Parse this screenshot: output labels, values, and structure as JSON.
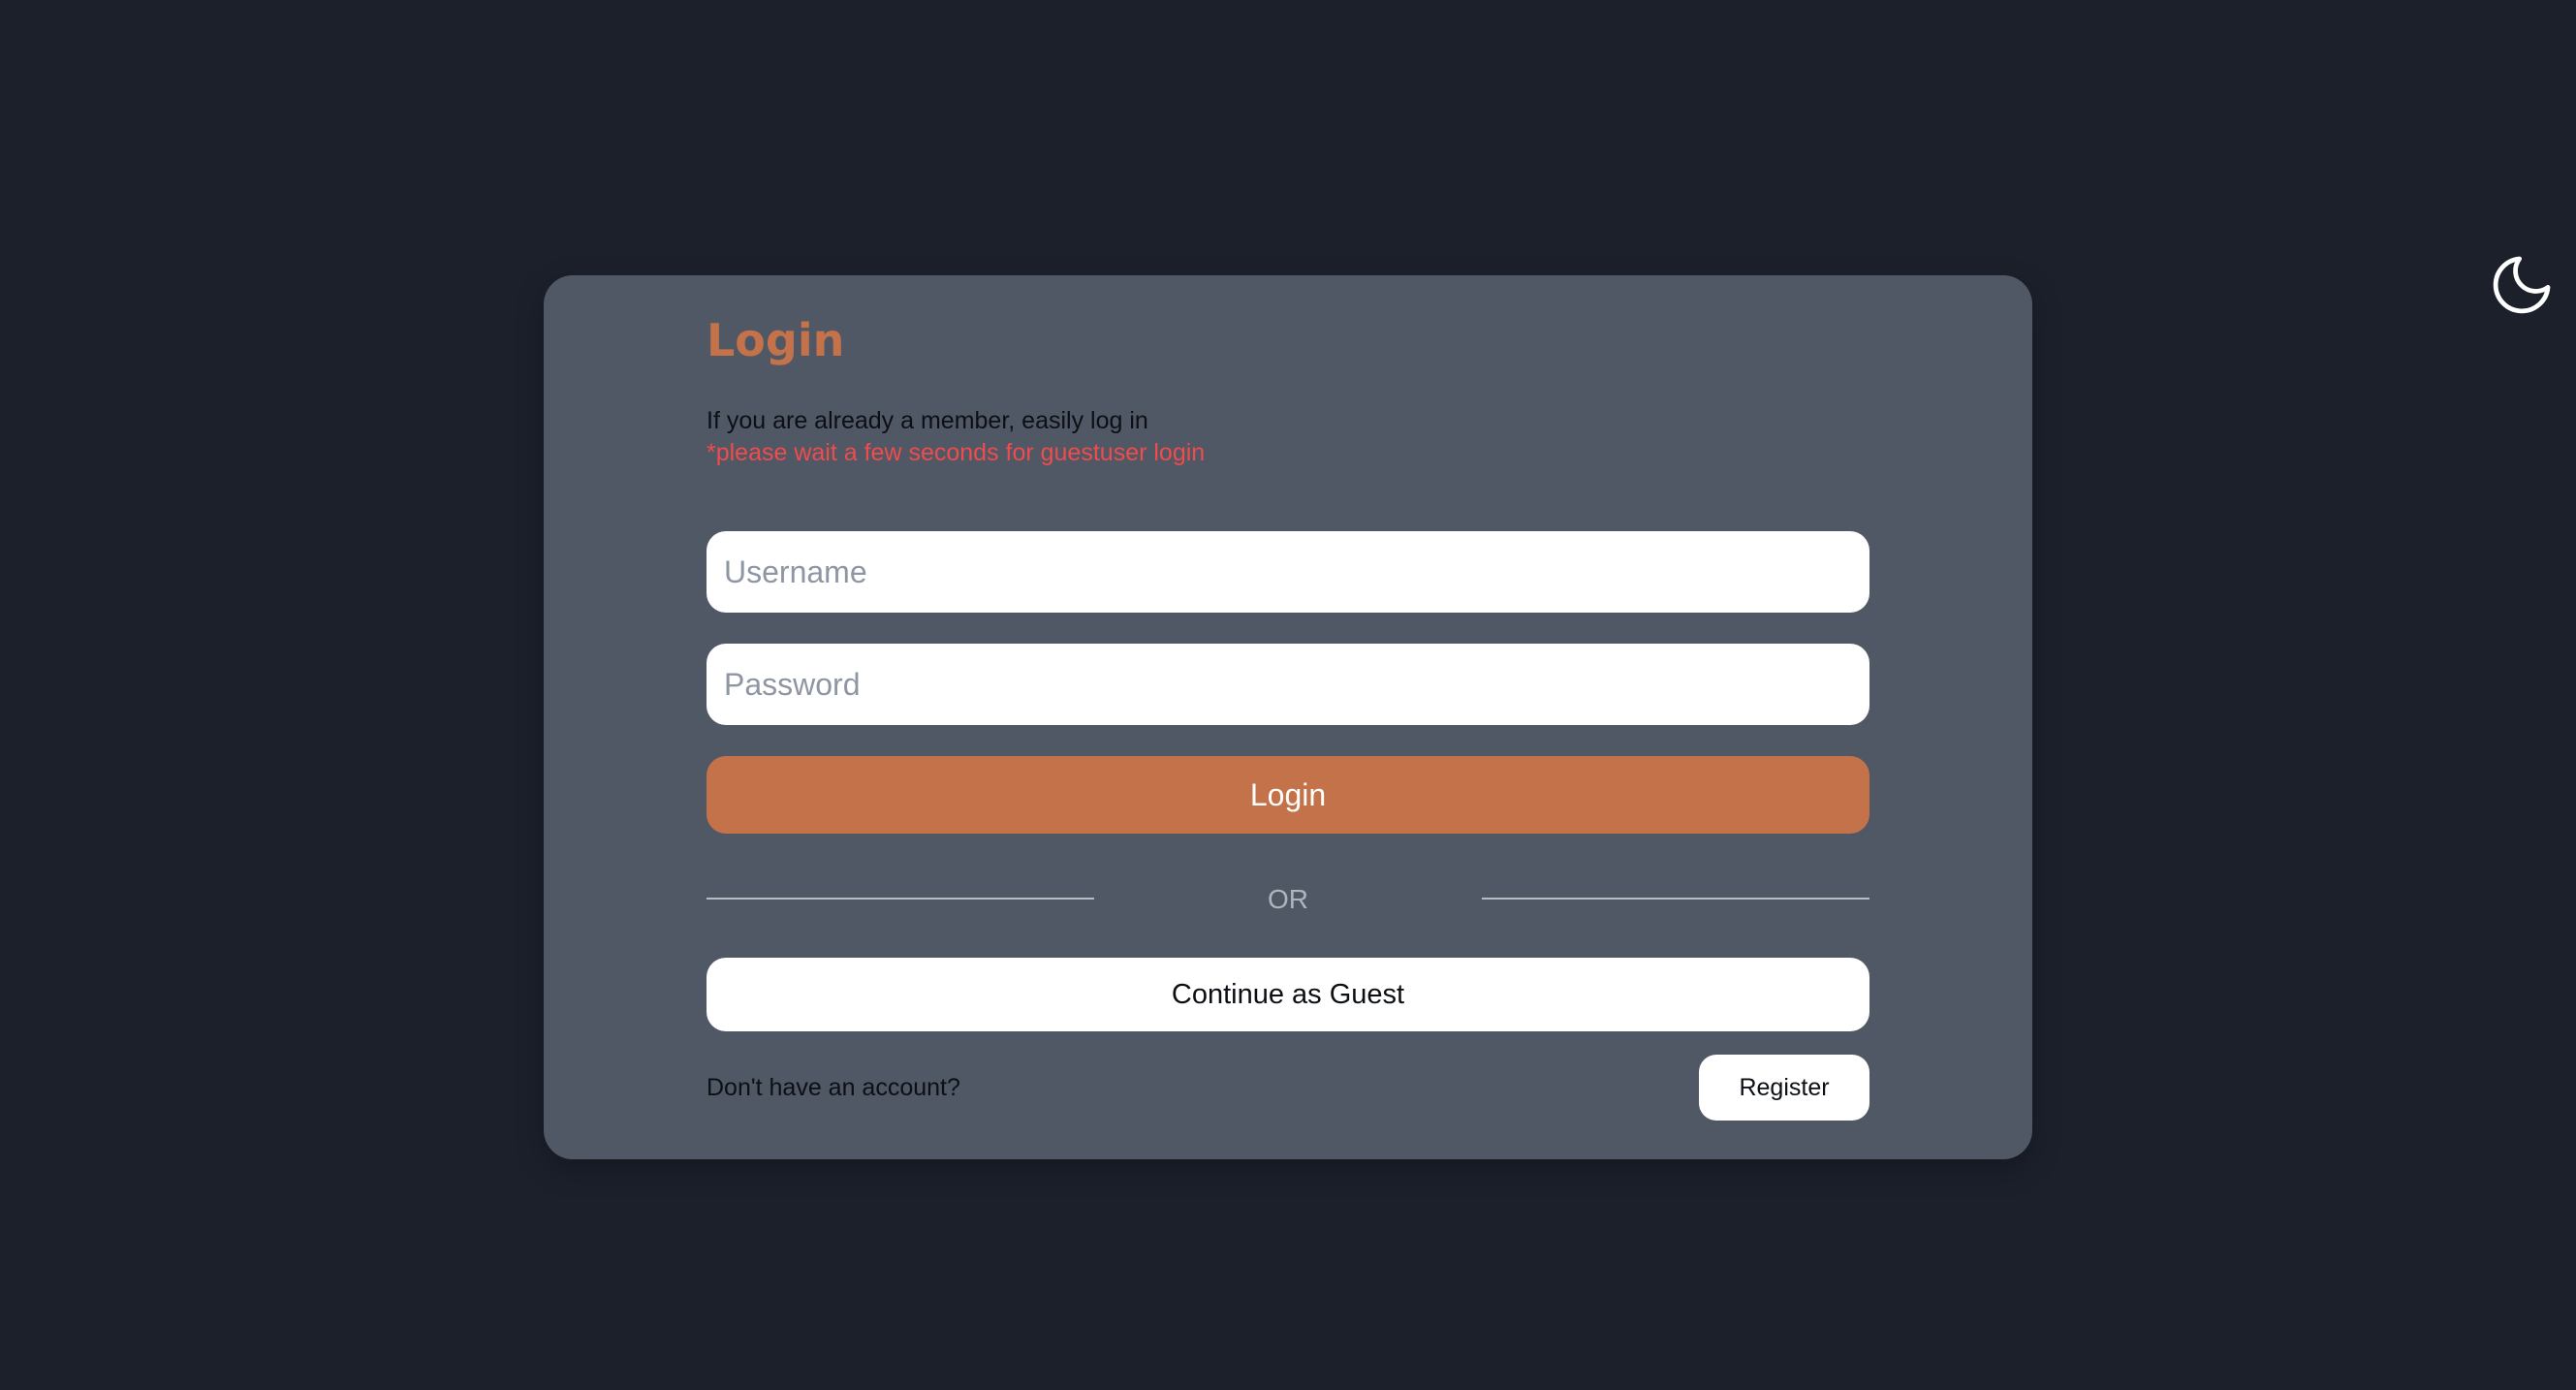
{
  "theme_toggle": {
    "icon": "moon-icon",
    "color": "#ffffff"
  },
  "login_card": {
    "title": "Login",
    "subtitle": "If you are already a member, easily log in",
    "note": "*please wait a few seconds for guestuser login",
    "username_placeholder": "Username",
    "password_placeholder": "Password",
    "login_button": "Login",
    "or_text": "OR",
    "guest_button": "Continue as Guest",
    "no_account_text": "Don't have an account?",
    "register_button": "Register"
  },
  "colors": {
    "background": "#1c202b",
    "card": "#505765",
    "accent": "#c4724a",
    "note": "#ef4c4c"
  }
}
